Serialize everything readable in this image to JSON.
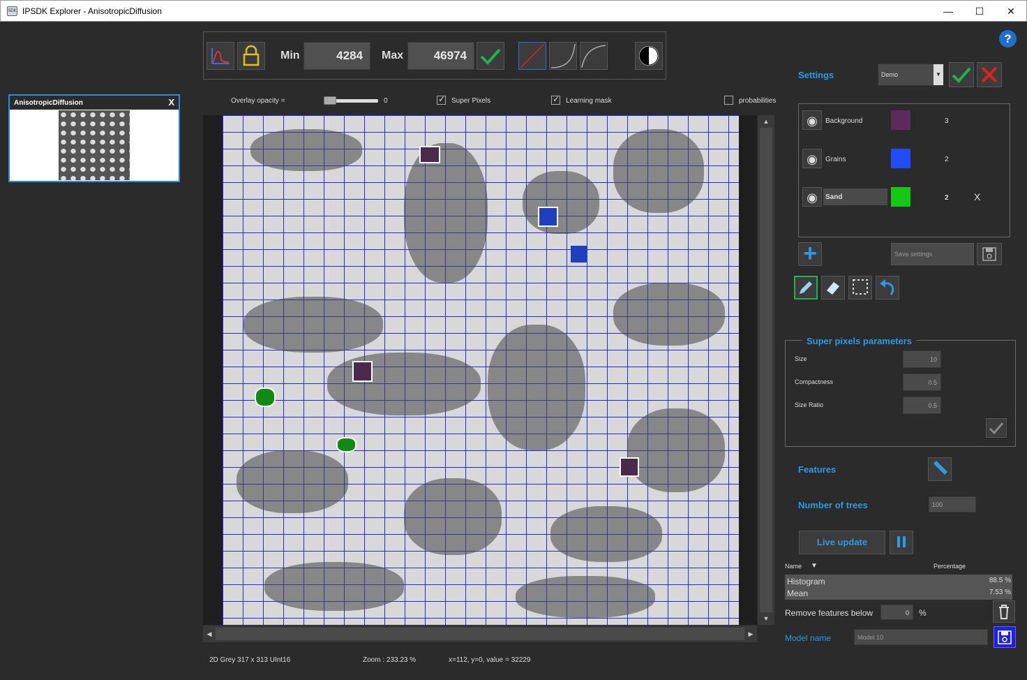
{
  "window": {
    "title": "IPSDK Explorer - AnisotropicDiffusion",
    "minimize": "—",
    "maximize": "☐",
    "close": "✕"
  },
  "toolbar": {
    "min_label": "Min",
    "min_value": "4284",
    "max_label": "Max",
    "max_value": "46974"
  },
  "overlay": {
    "opacity_label": "Overlay opacity =",
    "opacity_value": "0",
    "super_pixels": "Super Pixels",
    "learning_mask": "Learning mask",
    "probabilities": "probabilities"
  },
  "thumbnail": {
    "title": "AnisotropicDiffusion",
    "close": "X"
  },
  "help": "?",
  "settings": {
    "label": "Settings",
    "preset": "Demo",
    "classes": [
      {
        "name": "Background",
        "color": "#5e2a5e",
        "count": "3"
      },
      {
        "name": "Grains",
        "color": "#1f4cff",
        "count": "2"
      },
      {
        "name": "Sand",
        "color": "#14c814",
        "count": "2",
        "delete": "X"
      }
    ],
    "save_settings": "Save settings"
  },
  "superpixels": {
    "title": "Super pixels parameters",
    "size_label": "Size",
    "size_value": "10",
    "compactness_label": "Compactness",
    "compactness_value": "0.5",
    "ratio_label": "Size Ratio",
    "ratio_value": "0.5"
  },
  "features_label": "Features",
  "trees": {
    "label": "Number of trees",
    "value": "100"
  },
  "live_update": "Live update",
  "feature_table": {
    "name_header": "Name",
    "percent_header": "Percentage",
    "rows": [
      {
        "name": "Histogram",
        "pct": "88.5 %"
      },
      {
        "name": "Mean",
        "pct": "7.53 %"
      }
    ]
  },
  "remove_below": {
    "label": "Remove features below",
    "value": "0",
    "unit": "%"
  },
  "model": {
    "label": "Model name",
    "placeholder": "Model 10"
  },
  "status": {
    "info": "2D Grey 317 x 313 UInt16",
    "zoom": "Zoom : 233.23 %",
    "cursor": "x=112, y=0, value = 32229"
  },
  "colors": {
    "accent": "#2a9be6",
    "check": "#22b14c",
    "cancel": "#e02020"
  }
}
